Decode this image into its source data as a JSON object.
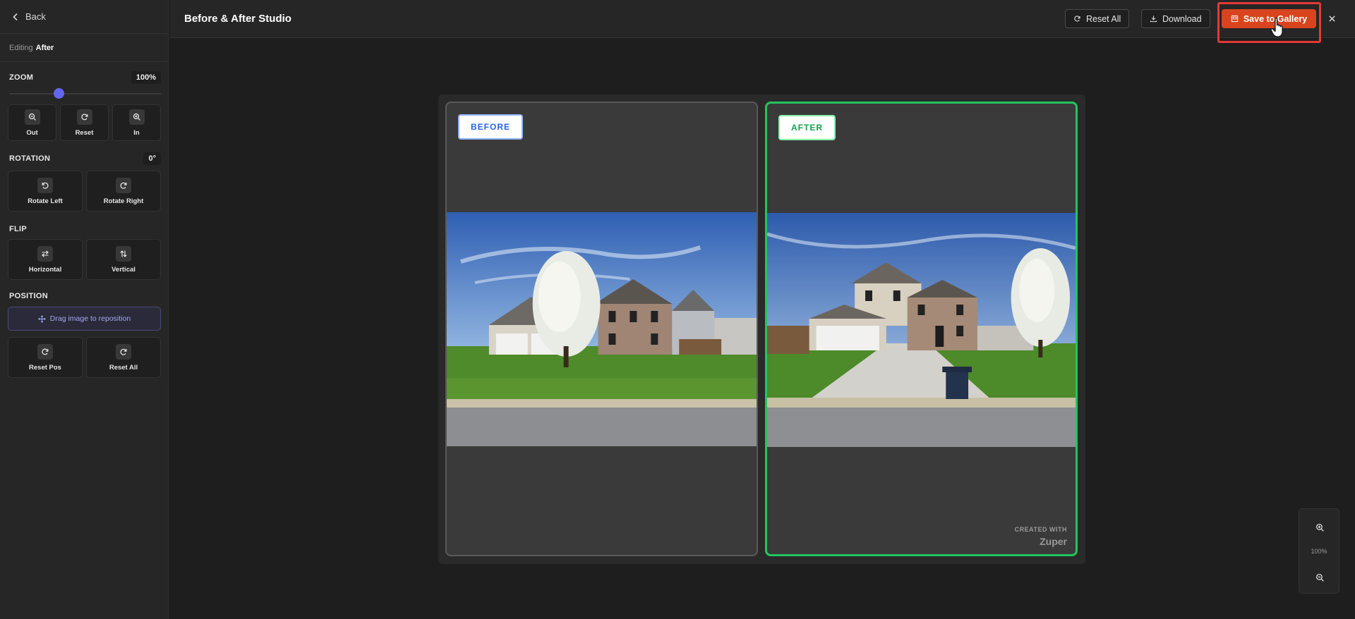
{
  "sidebar": {
    "back_label": "Back",
    "editing_prefix": "Editing",
    "editing_target": "After",
    "zoom": {
      "heading": "ZOOM",
      "value": "100%",
      "level": 0.33,
      "out_label": "Out",
      "reset_label": "Reset",
      "in_label": "In"
    },
    "rotation": {
      "heading": "ROTATION",
      "value": "0°",
      "left_label": "Rotate Left",
      "right_label": "Rotate Right"
    },
    "flip": {
      "heading": "FLIP",
      "horizontal_label": "Horizontal",
      "vertical_label": "Vertical"
    },
    "position": {
      "heading": "POSITION",
      "drag_hint": "Drag image to reposition",
      "reset_pos_label": "Reset Pos",
      "reset_all_label": "Reset All"
    }
  },
  "topbar": {
    "title": "Before & After Studio",
    "reset_all_label": "Reset All",
    "download_label": "Download",
    "save_label": "Save to Gallery"
  },
  "canvas": {
    "before_tag": "BEFORE",
    "after_tag": "AFTER",
    "watermark_line1": "CREATED WITH",
    "watermark_line2": "Zuper"
  },
  "zoom_float": {
    "value": "100%"
  },
  "colors": {
    "accent": "#6366f1",
    "save": "#d9441e",
    "after_border": "#22c55e",
    "before_tag": "#2563eb",
    "highlight": "#e53935"
  },
  "icons": [
    "chevron-left-icon",
    "zoom-out-icon",
    "refresh-icon",
    "zoom-in-icon",
    "rotate-left-icon",
    "rotate-right-icon",
    "flip-horizontal-icon",
    "flip-vertical-icon",
    "move-icon",
    "download-icon",
    "save-icon",
    "close-icon",
    "hand-cursor-icon"
  ]
}
